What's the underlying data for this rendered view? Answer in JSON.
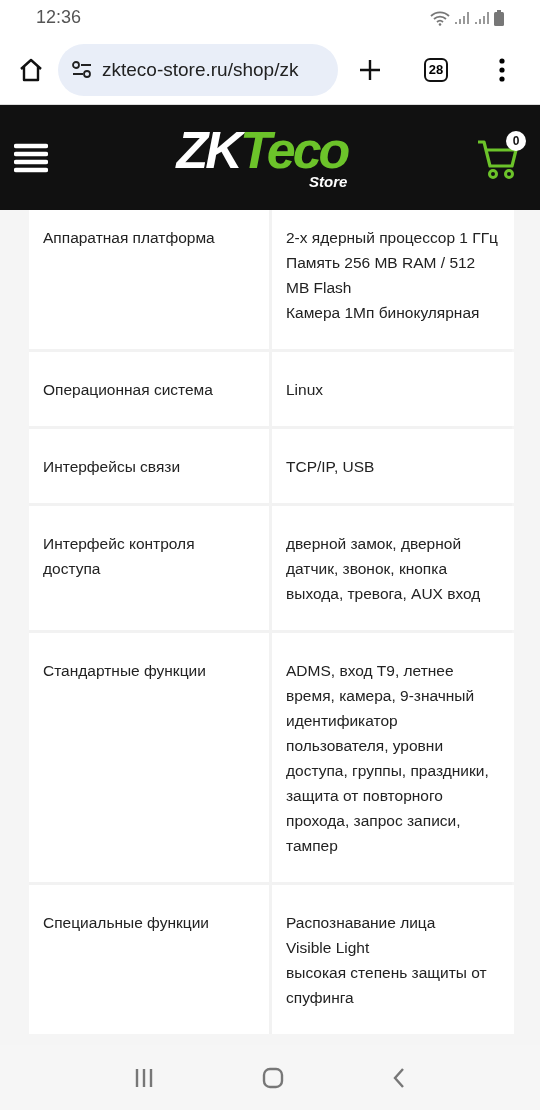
{
  "status_bar": {
    "time": "12:36"
  },
  "browser": {
    "url": "zkteco-store.ru/shop/zk",
    "tab_count": "28"
  },
  "header": {
    "logo": {
      "main": "ZK",
      "accent": "Teco",
      "sub": "Store"
    },
    "cart_count": "0"
  },
  "specs": [
    {
      "name": "Аппаратная платформа",
      "values": [
        "2-х ядерный процессор 1 ГГц",
        "Память 256 MB RAM / 512 MB Flash",
        "Камера 1Мп бинокулярная"
      ]
    },
    {
      "name": "Операционная система",
      "values": [
        "Linux"
      ]
    },
    {
      "name": "Интерфейсы связи",
      "values": [
        "TCP/IP, USB"
      ]
    },
    {
      "name": "Интерфейс контроля доступа",
      "values": [
        "дверной замок, дверной датчик, звонок, кнопка выхода, тревога, AUX вход"
      ]
    },
    {
      "name": "Стандартные функции",
      "values": [
        "ADMS, вход T9, летнее время, камера, 9-значный идентификатор пользователя, уровни доступа, группы, праздники, защита от повторного прохода, запрос записи, тампер"
      ]
    },
    {
      "name": "Специальные функции",
      "values": [
        "Распознавание лица",
        "Visible Light",
        "высокая степень защиты от спуфинга"
      ]
    }
  ]
}
